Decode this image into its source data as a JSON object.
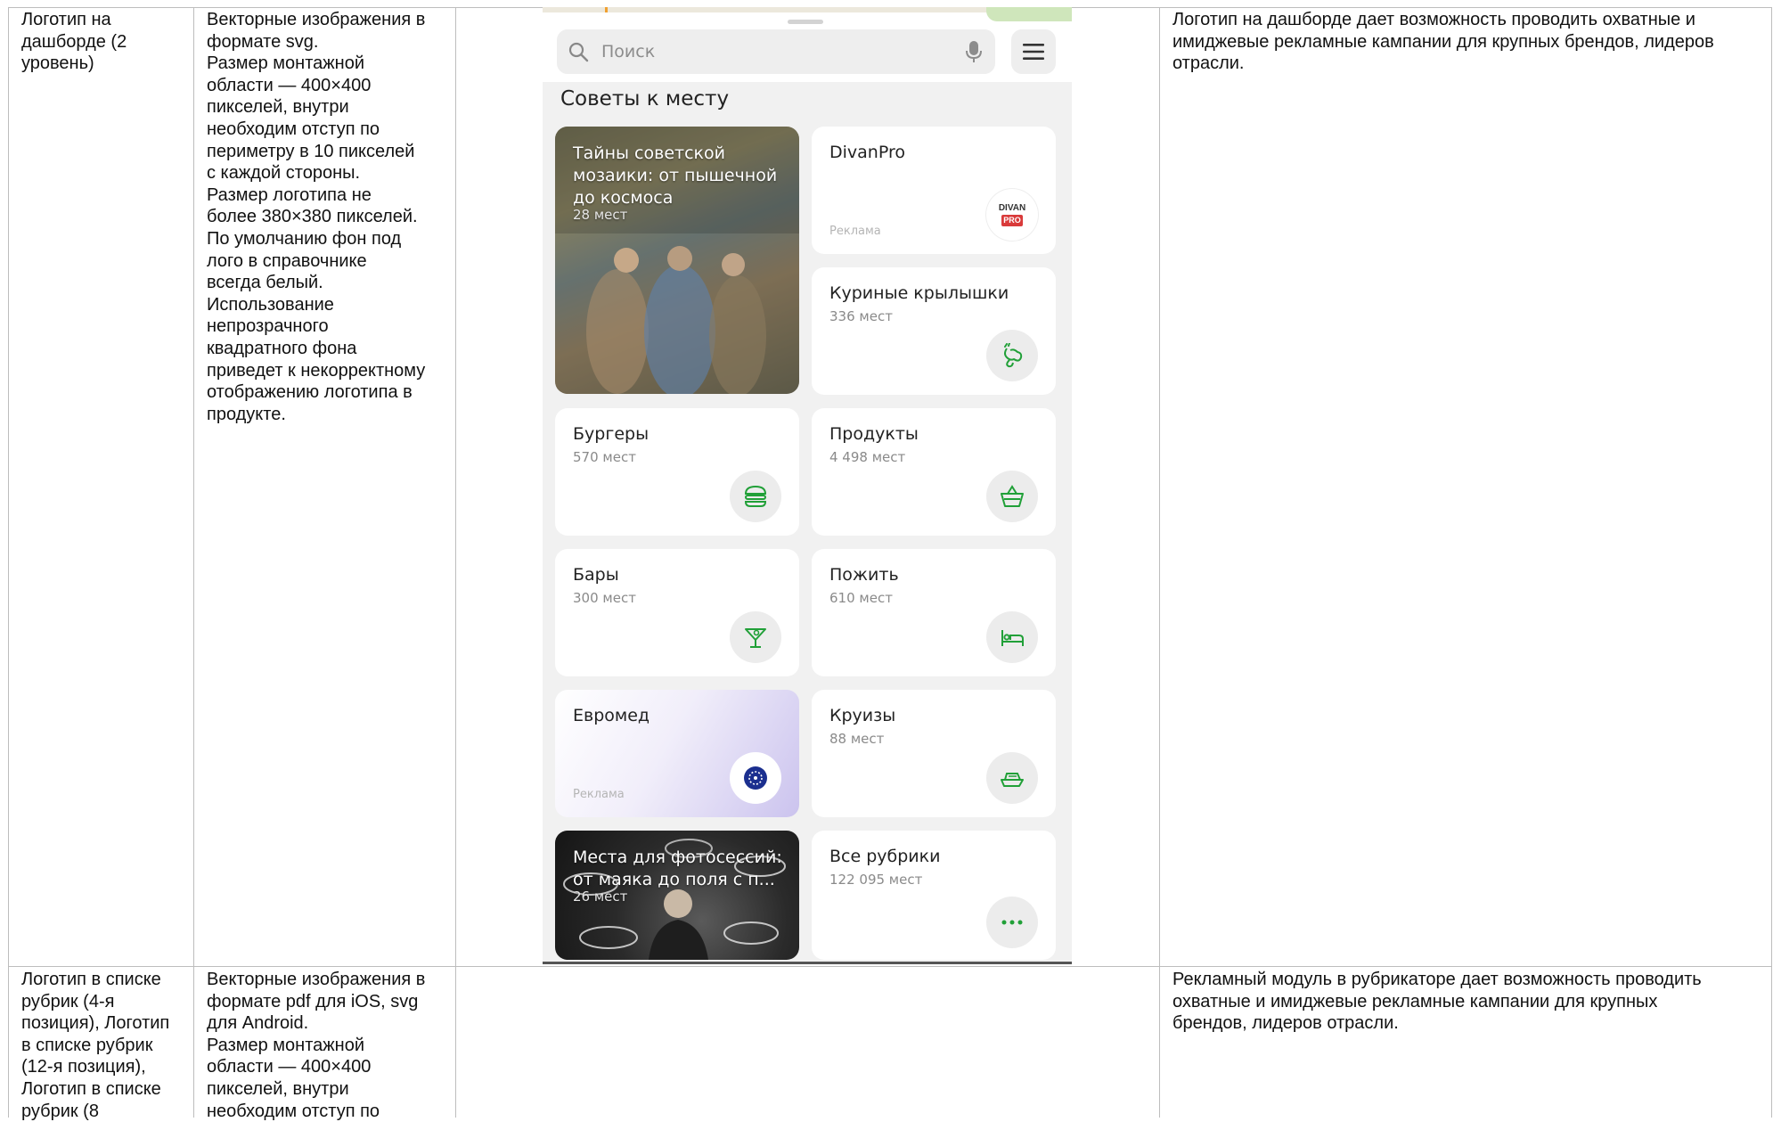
{
  "table": {
    "row1": {
      "col1": "Логотип на\nдашборде (2\nуровень)",
      "col2": "Векторные изображения в\nформате svg.\nРазмер монтажной\nобласти — 400×400\nпикселей, внутри\nнеобходим отступ по\nпериметру в 10 пикселей\nс каждой стороны.\nРазмер логотипа не\nболее 380×380 пикселей.\nПо умолчанию фон под\nлого в справочнике\nвсегда белый.\nИспользование\nнепрозрачного\nквадратного фона\nприведет к некорректному\nотображению логотипа в\nпродукте.",
      "col4": "Логотип на дашборде дает возможность проводить охватные и\nимиджевые рекламные кампании для крупных брендов, лидеров\nотрасли."
    },
    "row2": {
      "col1": "Логотип в списке\nрубрик (4-я\nпозиция), Логотип\nв списке рубрик\n(12-я позиция),\nЛоготип в списке\nрубрик (8",
      "col2": "Векторные изображения в\nформате pdf для iOS, svg\nдля Android.\nРазмер монтажной\nобласти — 400×400\nпикселей, внутри\nнеобходим отступ по",
      "col4": "Рекламный модуль в рубрикаторе дает возможность проводить\nохватные и имиджевые рекламные кампании для крупных\nбрендов, лидеров отрасли."
    }
  },
  "phone": {
    "search_placeholder": "Поиск",
    "section_title": "Советы к месту",
    "ad_label": "Реклама",
    "cards": [
      {
        "title": "Тайны советской мозаики: от пышечной до космоса",
        "count": "28 мест",
        "kind": "photo"
      },
      {
        "title": "DivanPro",
        "badge_top": "DIVAN",
        "badge_bottom": "PRO",
        "kind": "ad"
      },
      {
        "title": "Куриные крылышки",
        "count": "336 мест",
        "icon": "chicken-wing-icon"
      },
      {
        "title": "Бургеры",
        "count": "570 мест",
        "icon": "burger-icon"
      },
      {
        "title": "Продукты",
        "count": "4 498 мест",
        "icon": "basket-icon"
      },
      {
        "title": "Бары",
        "count": "300 мест",
        "icon": "cocktail-icon"
      },
      {
        "title": "Пожить",
        "count": "610 мест",
        "icon": "bed-icon"
      },
      {
        "title": "Евромед",
        "kind": "ad",
        "icon": "euromed-logo-icon"
      },
      {
        "title": "Круизы",
        "count": "88 мест",
        "icon": "ship-icon"
      },
      {
        "title": "Места для фотосессий: от маяка до поля с п...",
        "count": "26 мест",
        "kind": "photo"
      },
      {
        "title": "Все рубрики",
        "count": "122 095 мест",
        "icon": "more-icon"
      }
    ]
  },
  "colors": {
    "accent": "#21a038",
    "border": "#bdbdbd",
    "phone_bg": "#f1f1f1"
  }
}
